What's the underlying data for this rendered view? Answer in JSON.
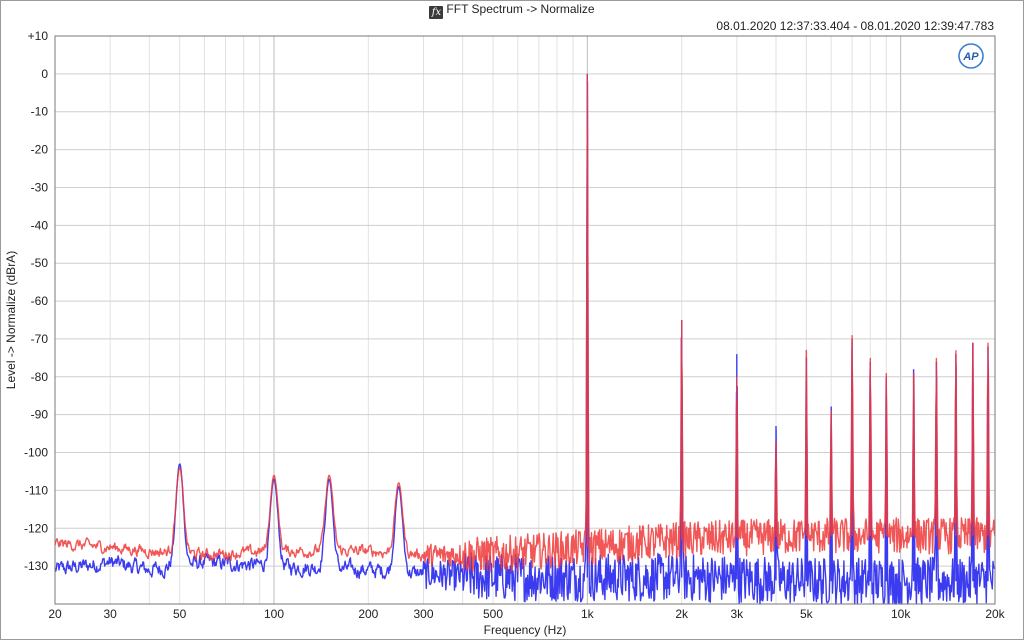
{
  "window": {
    "title": "FFT Spectrum -> Normalize",
    "icon": "fx-icon",
    "timestamp": "08.01.2020 12:37:33.404 - 08.01.2020 12:39:47.783",
    "logo": "AP"
  },
  "chart_data": {
    "type": "line",
    "title": "FFT Spectrum -> Normalize",
    "xlabel": "Frequency (Hz)",
    "ylabel": "Level -> Normalize (dBrA)",
    "xscale": "log",
    "xlim": [
      20,
      20000
    ],
    "ylim": [
      -140,
      10
    ],
    "grid": true,
    "xticks": [
      {
        "value": 20,
        "label": "20"
      },
      {
        "value": 30,
        "label": "30"
      },
      {
        "value": 50,
        "label": "50"
      },
      {
        "value": 100,
        "label": "100"
      },
      {
        "value": 200,
        "label": "200"
      },
      {
        "value": 300,
        "label": "300"
      },
      {
        "value": 500,
        "label": "500"
      },
      {
        "value": 1000,
        "label": "1k"
      },
      {
        "value": 2000,
        "label": "2k"
      },
      {
        "value": 3000,
        "label": "3k"
      },
      {
        "value": 5000,
        "label": "5k"
      },
      {
        "value": 10000,
        "label": "10k"
      },
      {
        "value": 20000,
        "label": "20k"
      }
    ],
    "yticks": [
      {
        "value": 10,
        "label": "+10"
      },
      {
        "value": 0,
        "label": "0"
      },
      {
        "value": -10,
        "label": "-10"
      },
      {
        "value": -20,
        "label": "-20"
      },
      {
        "value": -30,
        "label": "-30"
      },
      {
        "value": -40,
        "label": "-40"
      },
      {
        "value": -50,
        "label": "-50"
      },
      {
        "value": -60,
        "label": "-60"
      },
      {
        "value": -70,
        "label": "-70"
      },
      {
        "value": -80,
        "label": "-80"
      },
      {
        "value": -90,
        "label": "-90"
      },
      {
        "value": -100,
        "label": "-100"
      },
      {
        "value": -110,
        "label": "-110"
      },
      {
        "value": -120,
        "label": "-120"
      },
      {
        "value": -130,
        "label": "-130"
      }
    ],
    "series": [
      {
        "color": "#3b3bf0",
        "noise_floor": [
          [
            20,
            -131
          ],
          [
            30,
            -129
          ],
          [
            40,
            -131
          ],
          [
            60,
            -129
          ],
          [
            100,
            -130
          ],
          [
            200,
            -131
          ],
          [
            300,
            -132
          ],
          [
            500,
            -133
          ],
          [
            1000,
            -133
          ],
          [
            2000,
            -133
          ],
          [
            5000,
            -134
          ],
          [
            10000,
            -134
          ],
          [
            20000,
            -134
          ]
        ],
        "noise_amplitude": 4,
        "peaks": [
          [
            50,
            -103
          ],
          [
            100,
            -107
          ],
          [
            150,
            -107
          ],
          [
            250,
            -109
          ],
          [
            1000,
            0
          ],
          [
            2000,
            -65
          ],
          [
            3000,
            -74
          ],
          [
            4000,
            -93
          ],
          [
            5000,
            -75
          ],
          [
            6000,
            -88
          ],
          [
            7000,
            -70
          ],
          [
            8000,
            -76
          ],
          [
            9000,
            -80
          ],
          [
            11000,
            -78
          ],
          [
            13000,
            -76
          ],
          [
            15000,
            -74
          ],
          [
            17000,
            -71
          ],
          [
            19000,
            -72
          ]
        ]
      },
      {
        "color": "#f03a3a",
        "noise_floor": [
          [
            20,
            -124
          ],
          [
            30,
            -125
          ],
          [
            40,
            -126
          ],
          [
            60,
            -127
          ],
          [
            100,
            -126
          ],
          [
            200,
            -126
          ],
          [
            300,
            -127
          ],
          [
            500,
            -127
          ],
          [
            1000,
            -125
          ],
          [
            2000,
            -123
          ],
          [
            5000,
            -122
          ],
          [
            10000,
            -122
          ],
          [
            20000,
            -122
          ]
        ],
        "noise_amplitude": 3,
        "peaks": [
          [
            50,
            -104
          ],
          [
            100,
            -106
          ],
          [
            150,
            -106
          ],
          [
            250,
            -108
          ],
          [
            1000,
            0
          ],
          [
            2000,
            -65
          ],
          [
            3000,
            -80
          ],
          [
            4000,
            -97
          ],
          [
            5000,
            -73
          ],
          [
            6000,
            -89
          ],
          [
            7000,
            -69
          ],
          [
            8000,
            -75
          ],
          [
            9000,
            -79
          ],
          [
            11000,
            -79
          ],
          [
            13000,
            -75
          ],
          [
            15000,
            -73
          ],
          [
            17000,
            -71
          ],
          [
            19000,
            -71
          ]
        ]
      }
    ]
  }
}
